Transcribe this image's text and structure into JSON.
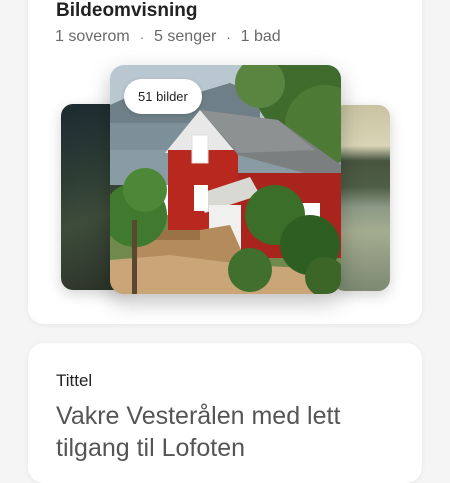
{
  "photos_section": {
    "heading": "Bildeomvisning",
    "specs": [
      "1 soverom",
      "5 senger",
      "1 bad"
    ],
    "photo_count_label": "51 bilder"
  },
  "title_section": {
    "label": "Tittel",
    "value": "Vakre Vesterålen med lett tilgang til Lofoten"
  }
}
